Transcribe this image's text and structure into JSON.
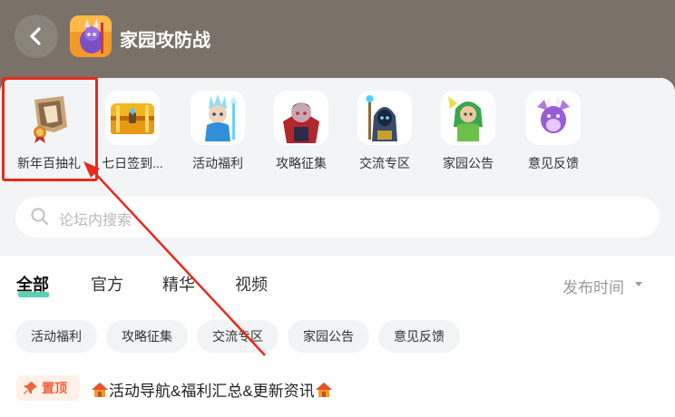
{
  "header": {
    "back_icon": "chevron-left-icon",
    "title": "家园攻防战",
    "bg_color": "#7a7268"
  },
  "shortcuts": [
    {
      "label": "新年百抽礼",
      "icon": "scroll-badge-icon"
    },
    {
      "label": "七日签到...",
      "icon": "treasure-chest-icon"
    },
    {
      "label": "活动福利",
      "icon": "ice-mage-icon"
    },
    {
      "label": "攻略征集",
      "icon": "vampire-icon"
    },
    {
      "label": "交流专区",
      "icon": "wizard-staff-icon"
    },
    {
      "label": "家园公告",
      "icon": "forest-elf-icon"
    },
    {
      "label": "意见反馈",
      "icon": "purple-dragon-icon"
    }
  ],
  "search": {
    "placeholder": "论坛内搜索"
  },
  "tabs": [
    {
      "label": "全部",
      "active": true
    },
    {
      "label": "官方",
      "active": false
    },
    {
      "label": "精华",
      "active": false
    },
    {
      "label": "视频",
      "active": false
    }
  ],
  "sort": {
    "label": "发布时间"
  },
  "chips": [
    "活动福利",
    "攻略征集",
    "交流专区",
    "家园公告",
    "意见反馈"
  ],
  "pinned_post": {
    "badge": "置顶",
    "title": "活动导航&福利汇总&更新资讯"
  },
  "colors": {
    "accent": "#3ec8a8",
    "highlight": "#e8291c",
    "pin": "#f0603a"
  }
}
